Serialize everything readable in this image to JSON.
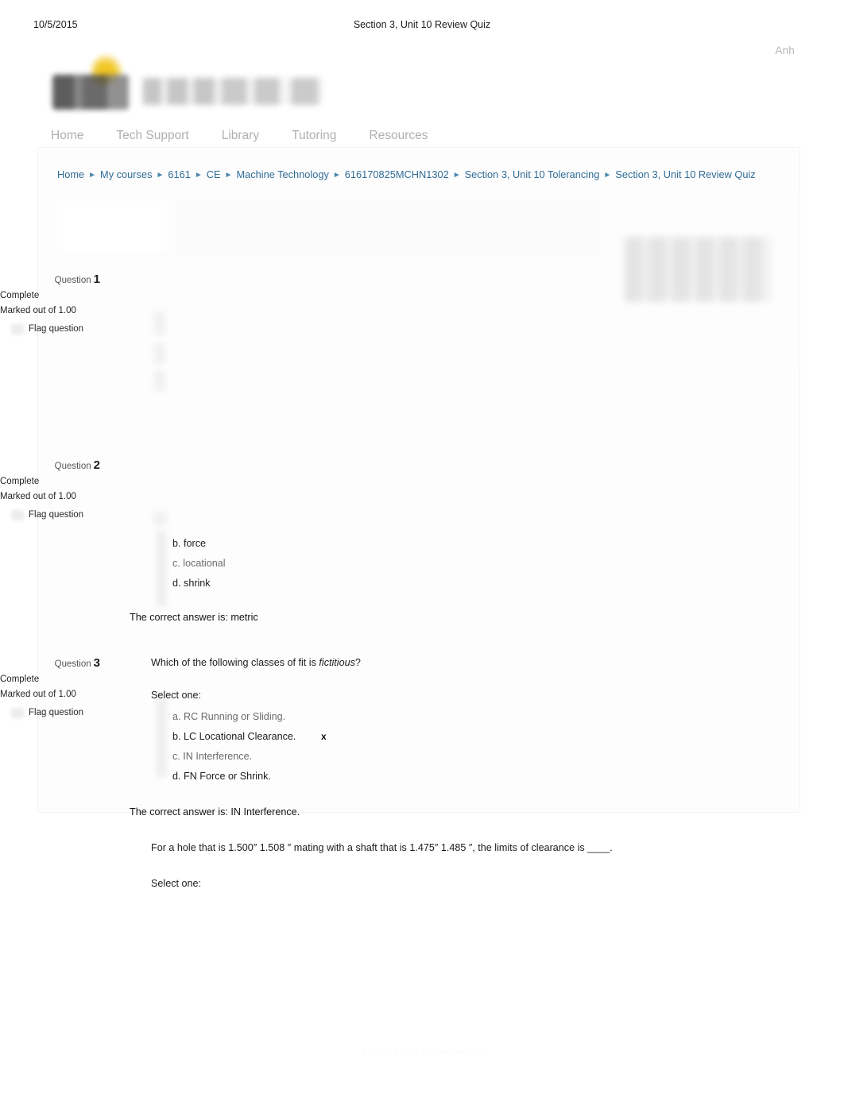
{
  "print_header": {
    "date": "10/5/2015",
    "title": "Section 3, Unit 10  Review Quiz"
  },
  "site": {
    "user": "Anh",
    "logo_alt": "EagleOnline 2"
  },
  "nav": {
    "items": [
      {
        "label": "Home"
      },
      {
        "label": "Tech Support"
      },
      {
        "label": "Library"
      },
      {
        "label": "Tutoring"
      },
      {
        "label": "Resources"
      }
    ]
  },
  "breadcrumb": {
    "separator": "►",
    "items": [
      {
        "label": "Home"
      },
      {
        "label": "My courses"
      },
      {
        "label": "6161"
      },
      {
        "label": "CE"
      },
      {
        "label": "Machine Technology"
      },
      {
        "label": "616170825MCHN1302"
      },
      {
        "label": "Section 3, Unit 10  Tolerancing"
      },
      {
        "label": "Section 3, Unit 10  Review Quiz"
      }
    ]
  },
  "questions": [
    {
      "title_label": "Question",
      "number": "1",
      "state": "Complete",
      "marks": "Marked out of 1.00",
      "flag_label": "Flag question",
      "text": "",
      "select_one_label": "",
      "options": [],
      "correct_answer": ""
    },
    {
      "title_label": "Question",
      "number": "2",
      "state": "Complete",
      "marks": "Marked out of 1.00",
      "flag_label": "Flag question",
      "text": "",
      "select_one_label": "",
      "options": [
        {
          "letter": "b.",
          "text": "force",
          "mark": ""
        },
        {
          "letter": "c.",
          "text": "locational",
          "mark": ""
        },
        {
          "letter": "d.",
          "text": "shrink",
          "mark": ""
        }
      ],
      "correct_answer": "The correct answer is: metric"
    },
    {
      "title_label": "Question",
      "number": "3",
      "state": "Complete",
      "marks": "Marked out of 1.00",
      "flag_label": "Flag question",
      "text_prefix": "Which of the following classes of fit is ",
      "text_emphasis": "fictitious",
      "text_suffix": "?",
      "select_one_label": "Select one:",
      "options": [
        {
          "letter": "a.",
          "text": "RC  Running or Sliding.",
          "mark": ""
        },
        {
          "letter": "b.",
          "text": "LC  Locational Clearance.",
          "mark": "x"
        },
        {
          "letter": "c.",
          "text": "IN  Interference.",
          "mark": ""
        },
        {
          "letter": "d.",
          "text": "FN  Force or Shrink.",
          "mark": ""
        }
      ],
      "correct_answer": "The correct answer is: IN  Interference."
    }
  ],
  "next_question_fragment": {
    "text": "For a hole that is 1.500″ 1.508 ″ mating with a shaft that is 1.475″ 1.485 ″, the limits of clearance is ____.",
    "select_one_label": "Select one:"
  }
}
